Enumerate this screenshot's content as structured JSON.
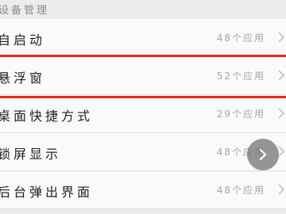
{
  "section": {
    "title": "设备管理"
  },
  "items": [
    {
      "label": "自启动",
      "count": "48个应用"
    },
    {
      "label": "悬浮窗",
      "count": "52个应用"
    },
    {
      "label": "桌面快捷方式",
      "count": "29个应用"
    },
    {
      "label": "锁屏显示",
      "count": "48个应用"
    },
    {
      "label": "后台弹出界面",
      "count": "48个应用"
    }
  ],
  "colors": {
    "highlight": "#e8261f"
  },
  "icons": {
    "row_chevron": "chevron-right-icon",
    "fab": "arrow-right-icon"
  }
}
